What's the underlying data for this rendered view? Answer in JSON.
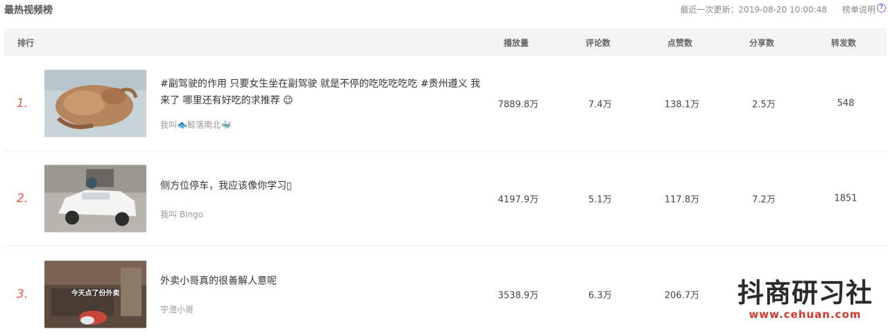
{
  "header": {
    "title": "最热视频榜",
    "update_label": "最近一次更新：2019-08-20 10:00:48",
    "explain_label": "榜单说明",
    "help_glyph": "?"
  },
  "columns": {
    "rank": "排行",
    "plays": "播放量",
    "comments": "评论数",
    "likes": "点赞数",
    "shares": "分享数",
    "reposts": "转发数"
  },
  "rows": [
    {
      "rank": "1.",
      "title": "#副驾驶的作用 只要女生坐在副驾驶 就是不停的吃吃吃吃吃 #贵州遵义 我来了 哪里还有好吃的求推荐 😉",
      "author": "我叫🐟鲸落南北🐳",
      "plays": "7889.8万",
      "comments": "7.4万",
      "likes": "138.1万",
      "shares": "2.5万",
      "reposts": "548"
    },
    {
      "rank": "2.",
      "title": "侧方位停车，我应该像你学习▯",
      "author": "我叫 Bingo",
      "plays": "4197.9万",
      "comments": "5.1万",
      "likes": "117.8万",
      "shares": "7.2万",
      "reposts": "1851"
    },
    {
      "rank": "3.",
      "title": "外卖小哥真的很善解人意呢",
      "author": "宇澄小哥",
      "thumb_caption": "今天点了份外卖",
      "plays": "3538.9万",
      "comments": "6.3万",
      "likes": "206.7万",
      "shares": "",
      "reposts": ""
    }
  ],
  "watermark": {
    "name": "抖商研习社",
    "url": "www.cehuan.com"
  }
}
